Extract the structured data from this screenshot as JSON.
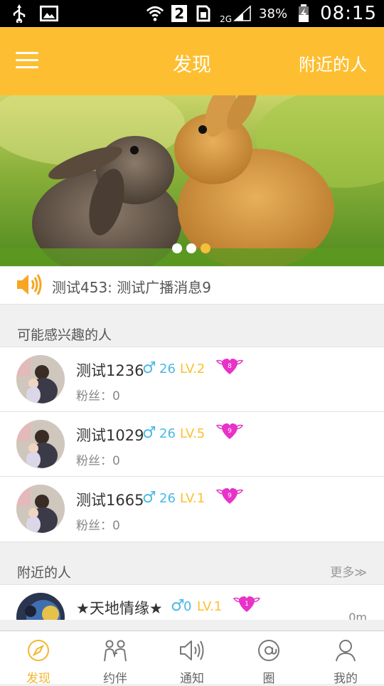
{
  "status_bar": {
    "time": "08:15",
    "battery": "38%",
    "sim_slot": "2",
    "network": "2G"
  },
  "header": {
    "title": "发现",
    "right_action": "附近的人"
  },
  "banner": {
    "dots": 3,
    "active_dot": 3
  },
  "broadcast": {
    "text": "测试453: 测试广播消息9"
  },
  "interested_section": {
    "title": "可能感兴趣的人",
    "users": [
      {
        "name": "测试1236",
        "gender": "♂",
        "age": "26",
        "level": "LV.2",
        "heart_num": "8",
        "fans": "粉丝：0"
      },
      {
        "name": "测试1029",
        "gender": "♂",
        "age": "26",
        "level": "LV.5",
        "heart_num": "9",
        "fans": "粉丝：0"
      },
      {
        "name": "测试1665",
        "gender": "♂",
        "age": "26",
        "level": "LV.1",
        "heart_num": "9",
        "fans": "粉丝：0"
      }
    ]
  },
  "nearby_section": {
    "title": "附近的人",
    "more": "更多≫",
    "users": [
      {
        "name": "★天地情缘★",
        "gender": "♂",
        "age": "0",
        "level": "LV.1",
        "heart_num": "1",
        "distance": "0m"
      }
    ]
  },
  "bottom_nav": [
    {
      "label": "发现",
      "icon": "compass-icon",
      "active": true
    },
    {
      "label": "约伴",
      "icon": "companions-icon",
      "active": false
    },
    {
      "label": "通知",
      "icon": "speaker-icon",
      "active": false
    },
    {
      "label": "圈",
      "icon": "at-circle-icon",
      "active": false
    },
    {
      "label": "我的",
      "icon": "person-icon",
      "active": false
    }
  ],
  "colors": {
    "accent": "#fdbf31",
    "gender": "#4ab8e6",
    "heart": "#e832c8"
  }
}
